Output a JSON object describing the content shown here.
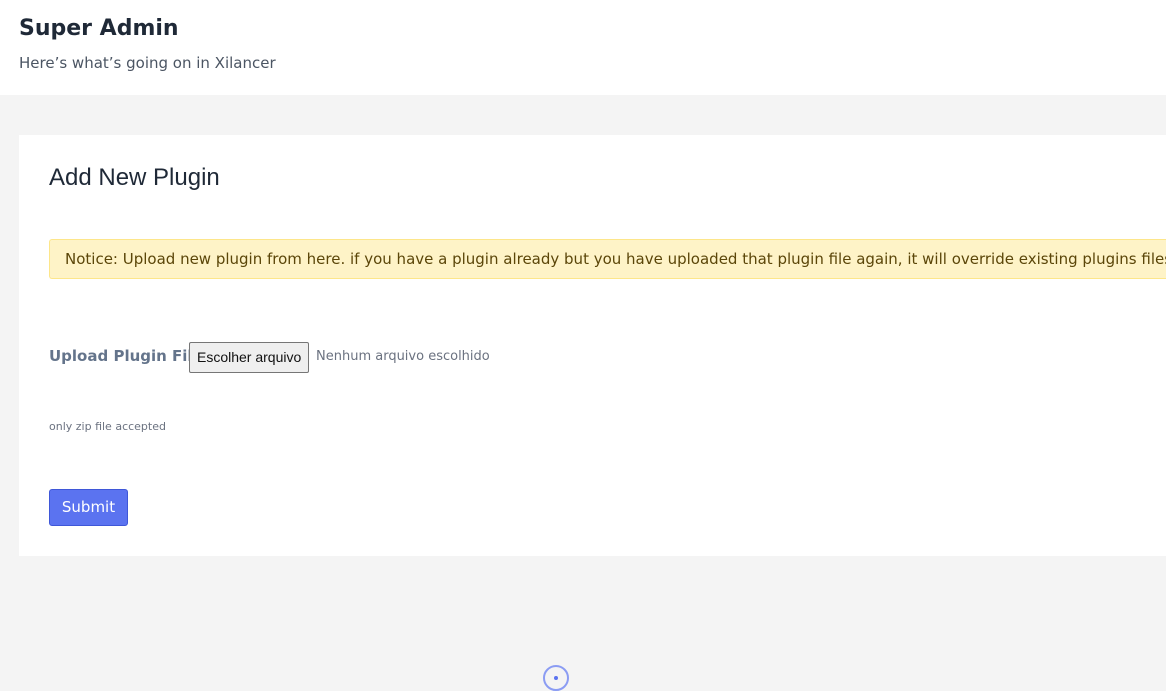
{
  "header": {
    "title": "Super Admin",
    "subtitle": "Here’s what’s going on in Xilancer"
  },
  "card": {
    "title": "Add New Plugin",
    "notice": "Notice: Upload new plugin from here. if you have a plugin already but you have uploaded that plugin file again, it will override existing plugins files",
    "upload_label": "Upload Plugin File",
    "file_button_label": "Escolher arquivo",
    "file_status": "Nenhum arquivo escolhido",
    "help_text": "only zip file accepted",
    "submit_label": "Submit"
  },
  "icons": {
    "loader": "loader-icon"
  },
  "colors": {
    "accent": "#5b73f0",
    "notice_background": "#fef3c7",
    "notice_text": "#5b4609"
  }
}
